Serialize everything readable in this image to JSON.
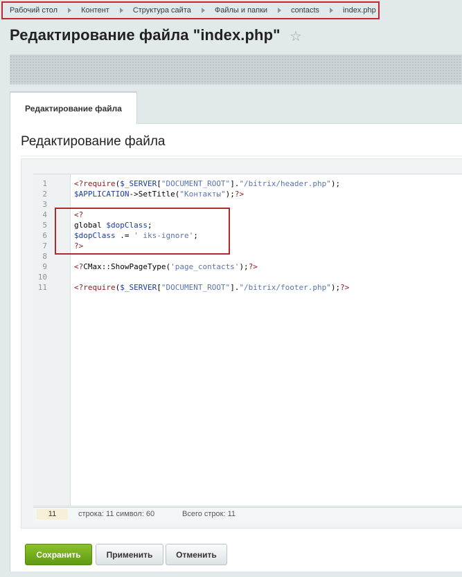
{
  "breadcrumb": [
    "Рабочий стол",
    "Контент",
    "Структура сайта",
    "Файлы и папки",
    "contacts",
    "index.php"
  ],
  "page_title": "Редактирование файла \"index.php\"",
  "tab_label": "Редактирование файла",
  "section_title": "Редактирование файла",
  "code_lines": [
    {
      "no": "1",
      "text": "<?require($_SERVER[\"DOCUMENT_ROOT\"].\"/bitrix/header.php\");"
    },
    {
      "no": "2",
      "text": "$APPLICATION->SetTitle(\"Контакты\");?>"
    },
    {
      "no": "3",
      "text": ""
    },
    {
      "no": "4",
      "text": "<?"
    },
    {
      "no": "5",
      "text": "global $dopClass;"
    },
    {
      "no": "6",
      "text": "$dopClass .= ' iks-ignore';"
    },
    {
      "no": "7",
      "text": "?>"
    },
    {
      "no": "8",
      "text": ""
    },
    {
      "no": "9",
      "text": "<?CMax::ShowPageType('page_contacts');?>"
    },
    {
      "no": "10",
      "text": ""
    },
    {
      "no": "11",
      "text": "<?require($_SERVER[\"DOCUMENT_ROOT\"].\"/bitrix/footer.php\");?>"
    }
  ],
  "status": {
    "current_line": "11",
    "info": "строка: 11  символ: 60",
    "total": "Всего строк: 11"
  },
  "buttons": {
    "save": "Сохранить",
    "apply": "Применить",
    "cancel": "Отменить"
  },
  "colors": {
    "save_button": "#6aa718",
    "highlight_box": "#b02a2a",
    "keyword": "#8a1a1a",
    "string": "#5a73b5"
  },
  "icons": {
    "favorite": "star-icon"
  }
}
